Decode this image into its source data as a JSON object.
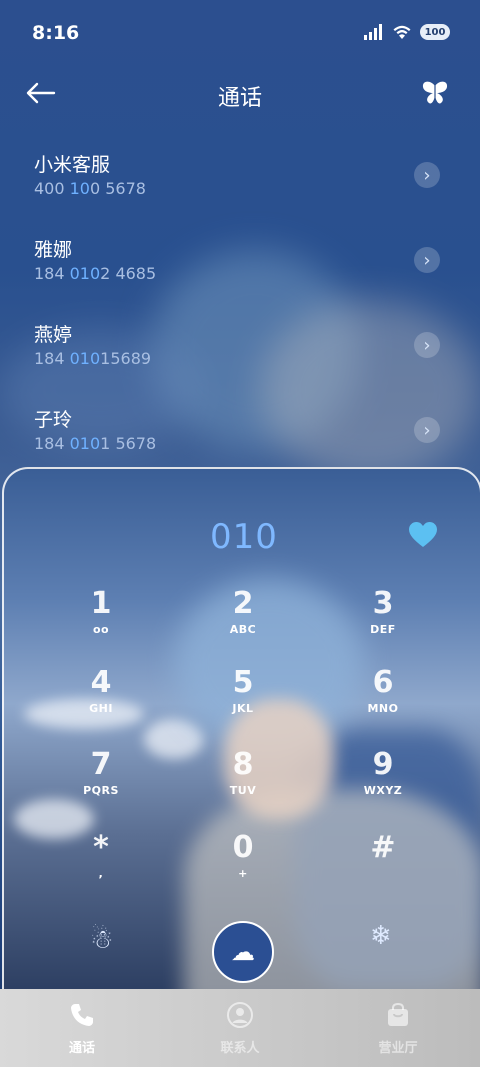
{
  "status_bar": {
    "time": "8:16",
    "battery": "100"
  },
  "header": {
    "title": "通话"
  },
  "contacts": [
    {
      "name": "小米客服",
      "number_pre": "400 ",
      "number_hl": "10",
      "number_post": "0 5678"
    },
    {
      "name": "雅娜",
      "number_pre": "184 ",
      "number_hl": "010",
      "number_post": "2 4685"
    },
    {
      "name": "燕婷",
      "number_pre": "184 ",
      "number_hl": "010",
      "number_post": "15689"
    },
    {
      "name": "子玲",
      "number_pre": "184 ",
      "number_hl": "010",
      "number_post": "1 5678"
    }
  ],
  "dialer": {
    "entered": "010",
    "keys": [
      {
        "digit": "1",
        "letters": ""
      },
      {
        "digit": "2",
        "letters": "ABC"
      },
      {
        "digit": "3",
        "letters": "DEF"
      },
      {
        "digit": "4",
        "letters": "GHI"
      },
      {
        "digit": "5",
        "letters": "JKL"
      },
      {
        "digit": "6",
        "letters": "MNO"
      },
      {
        "digit": "7",
        "letters": "PQRS"
      },
      {
        "digit": "8",
        "letters": "TUV"
      },
      {
        "digit": "9",
        "letters": "WXYZ"
      },
      {
        "digit": "*",
        "letters": ","
      },
      {
        "digit": "0",
        "letters": "+"
      },
      {
        "digit": "#",
        "letters": ""
      }
    ],
    "voicemail_glyph": "oo",
    "left_action_icon": "snowman-icon",
    "right_action_icon": "snowflake-icon",
    "call_icon": "cloud-rain-icon"
  },
  "tabs": [
    {
      "label": "通话",
      "icon": "phone-icon",
      "active": true
    },
    {
      "label": "联系人",
      "icon": "person-icon",
      "active": false
    },
    {
      "label": "营业厅",
      "icon": "bag-icon",
      "active": false
    }
  ]
}
